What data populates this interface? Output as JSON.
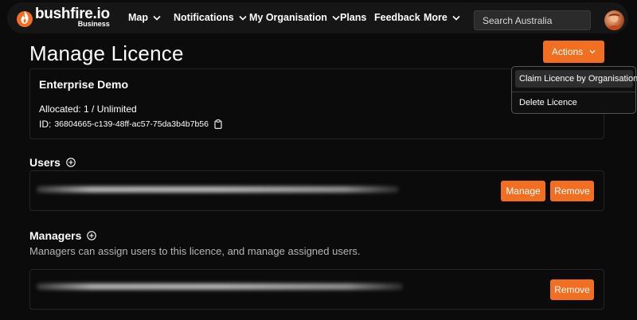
{
  "app": {
    "brand_name": "bushfire.io",
    "brand_sub": "Business",
    "colors": {
      "accent": "#f26f21",
      "background": "#0b0b0b",
      "navbar": "#161616"
    }
  },
  "nav": {
    "items": [
      {
        "label": "Map",
        "dropdown": true
      },
      {
        "label": "Notifications",
        "dropdown": true
      },
      {
        "label": "My Organisation",
        "dropdown": true
      },
      {
        "label": "Plans",
        "dropdown": false
      },
      {
        "label": "Feedback",
        "dropdown": false
      },
      {
        "label": "More",
        "dropdown": true
      }
    ],
    "search_placeholder": "Search Australia"
  },
  "page": {
    "title": "Manage Licence",
    "actions_label": "Actions",
    "actions_menu": [
      {
        "label": "Claim Licence by Organisation",
        "active": true
      },
      {
        "label": "Delete Licence",
        "active": false
      }
    ]
  },
  "licence": {
    "name": "Enterprise Demo",
    "allocated": "Allocated: 1 / Unlimited",
    "id_label": "ID:",
    "id_value": "36804665-c139-48ff-ac57-75da3b4b7b56"
  },
  "users": {
    "title": "Users",
    "manage_label": "Manage",
    "remove_label": "Remove"
  },
  "managers": {
    "title": "Managers",
    "description": "Managers can assign users to this licence, and manage assigned users.",
    "remove_label": "Remove"
  }
}
